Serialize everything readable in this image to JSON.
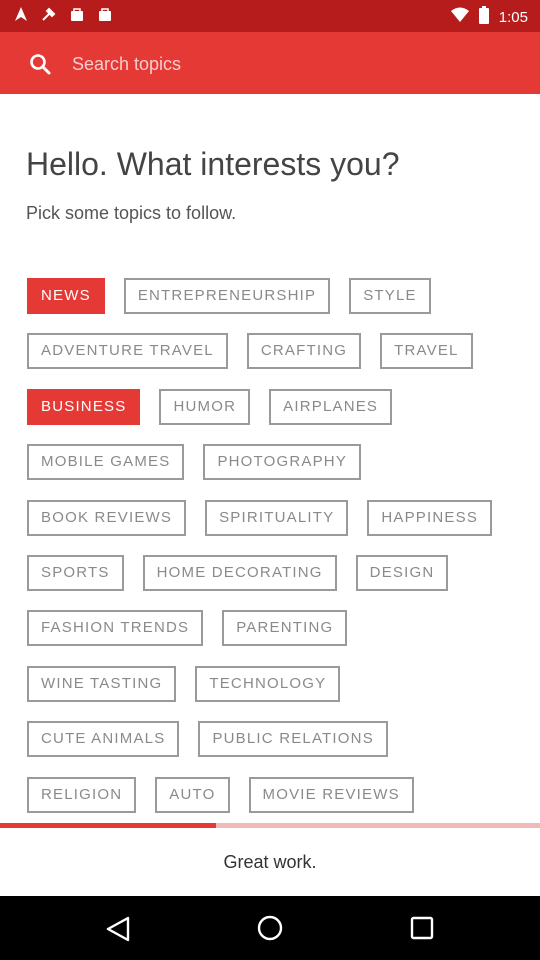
{
  "status_bar": {
    "time": "1:05",
    "left_icons": [
      "navigation-icon",
      "tool-icon",
      "bag-icon",
      "bag-icon"
    ],
    "right_icons": [
      "wifi-icon",
      "battery-icon"
    ]
  },
  "search": {
    "placeholder": "Search topics"
  },
  "heading": {
    "title": "Hello. What interests you?",
    "subtitle": "Pick some topics to follow."
  },
  "topics": [
    [
      {
        "label": "NEWS",
        "selected": true
      },
      {
        "label": "ENTREPRENEURSHIP",
        "selected": false
      },
      {
        "label": "STYLE",
        "selected": false
      }
    ],
    [
      {
        "label": "ADVENTURE TRAVEL",
        "selected": false
      },
      {
        "label": "CRAFTING",
        "selected": false
      },
      {
        "label": "TRAVEL",
        "selected": false
      }
    ],
    [
      {
        "label": "BUSINESS",
        "selected": true
      },
      {
        "label": "HUMOR",
        "selected": false
      },
      {
        "label": "AIRPLANES",
        "selected": false
      }
    ],
    [
      {
        "label": "MOBILE GAMES",
        "selected": false
      },
      {
        "label": "PHOTOGRAPHY",
        "selected": false
      }
    ],
    [
      {
        "label": "BOOK REVIEWS",
        "selected": false
      },
      {
        "label": "SPIRITUALITY",
        "selected": false
      },
      {
        "label": "HAPPINESS",
        "selected": false
      }
    ],
    [
      {
        "label": "SPORTS",
        "selected": false
      },
      {
        "label": "HOME DECORATING",
        "selected": false
      },
      {
        "label": "DESIGN",
        "selected": false
      }
    ],
    [
      {
        "label": "FASHION TRENDS",
        "selected": false
      },
      {
        "label": "PARENTING",
        "selected": false
      }
    ],
    [
      {
        "label": "WINE TASTING",
        "selected": false
      },
      {
        "label": "TECHNOLOGY",
        "selected": false
      }
    ],
    [
      {
        "label": "CUTE ANIMALS",
        "selected": false
      },
      {
        "label": "PUBLIC RELATIONS",
        "selected": false
      }
    ],
    [
      {
        "label": "RELIGION",
        "selected": false
      },
      {
        "label": "AUTO",
        "selected": false
      },
      {
        "label": "MOVIE REVIEWS",
        "selected": false
      }
    ]
  ],
  "progress": {
    "fraction": 0.4
  },
  "footer": {
    "message": "Great work."
  },
  "colors": {
    "accent": "#e53935",
    "status_bar": "#b71c1c",
    "chip_border": "#9a9a9a",
    "chip_text": "#8a8a8a"
  },
  "nav_bar": {
    "icons": [
      "back-icon",
      "home-icon",
      "recent-apps-icon"
    ]
  }
}
